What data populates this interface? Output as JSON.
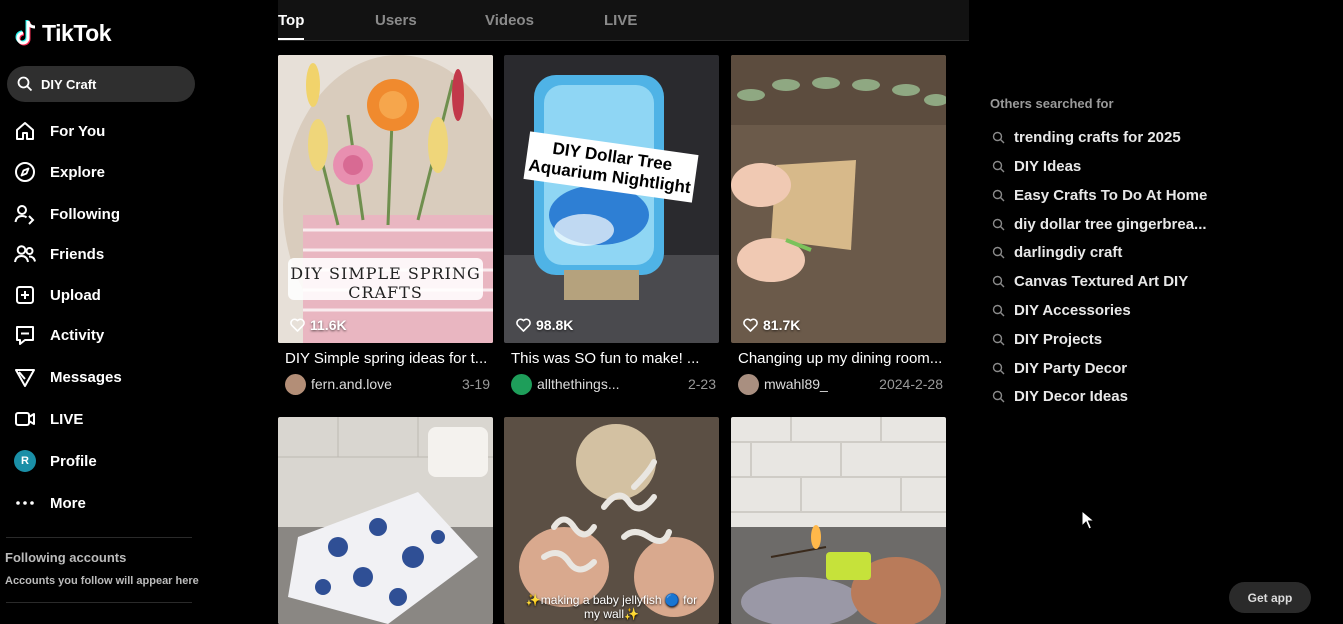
{
  "app": {
    "name": "TikTok"
  },
  "search": {
    "value": "DIY Craft"
  },
  "nav": [
    {
      "label": "For You",
      "icon": "home-icon"
    },
    {
      "label": "Explore",
      "icon": "compass-icon"
    },
    {
      "label": "Following",
      "icon": "following-icon"
    },
    {
      "label": "Friends",
      "icon": "friends-icon"
    },
    {
      "label": "Upload",
      "icon": "upload-icon"
    },
    {
      "label": "Activity",
      "icon": "activity-icon"
    },
    {
      "label": "Messages",
      "icon": "messages-icon"
    },
    {
      "label": "LIVE",
      "icon": "live-icon"
    },
    {
      "label": "Profile",
      "icon": "profile-avatar",
      "avatar_letter": "R"
    },
    {
      "label": "More",
      "icon": "more-icon"
    }
  ],
  "following": {
    "title": "Following accounts",
    "subtitle": "Accounts you follow will appear here"
  },
  "tabs": [
    {
      "label": "Top",
      "active": true
    },
    {
      "label": "Users",
      "active": false
    },
    {
      "label": "Videos",
      "active": false
    },
    {
      "label": "LIVE",
      "active": false
    }
  ],
  "videos": [
    {
      "likes": "11.6K",
      "caption": "DIY Simple spring ideas for t...",
      "user": "fern.and.love",
      "date": "3-19",
      "overlay_text": "DIY SIMPLE SPRING CRAFTS"
    },
    {
      "likes": "98.8K",
      "caption": "This was SO fun to make! ...",
      "user": "allthethings...",
      "date": "2-23",
      "overlay_text": "DIY Dollar Tree Aquarium Nightlight"
    },
    {
      "likes": "81.7K",
      "caption": "Changing up my dining room...",
      "user": "mwahl89_",
      "date": "2024-2-28",
      "overlay_text": ""
    },
    {
      "likes": "",
      "caption": "",
      "user": "",
      "date": "",
      "overlay_text": ""
    },
    {
      "likes": "",
      "caption": "",
      "user": "",
      "date": "",
      "overlay_text": "✨making a baby jellyfish 🔵 for my wall✨"
    },
    {
      "likes": "",
      "caption": "",
      "user": "",
      "date": "",
      "overlay_text": ""
    }
  ],
  "others": {
    "title": "Others searched for",
    "items": [
      "trending crafts for 2025",
      "DIY Ideas",
      "Easy Crafts To Do At Home",
      "diy dollar tree gingerbrea...",
      "darlingdiy craft",
      "Canvas Textured Art DIY",
      "DIY Accessories",
      "DIY Projects",
      "DIY Party Decor",
      "DIY Decor Ideas"
    ]
  },
  "get_app": {
    "label": "Get app"
  },
  "colors": {
    "brand_cyan": "#25f4ee",
    "brand_red": "#fe2c55",
    "profile_avatar": "#1a8fa7"
  }
}
